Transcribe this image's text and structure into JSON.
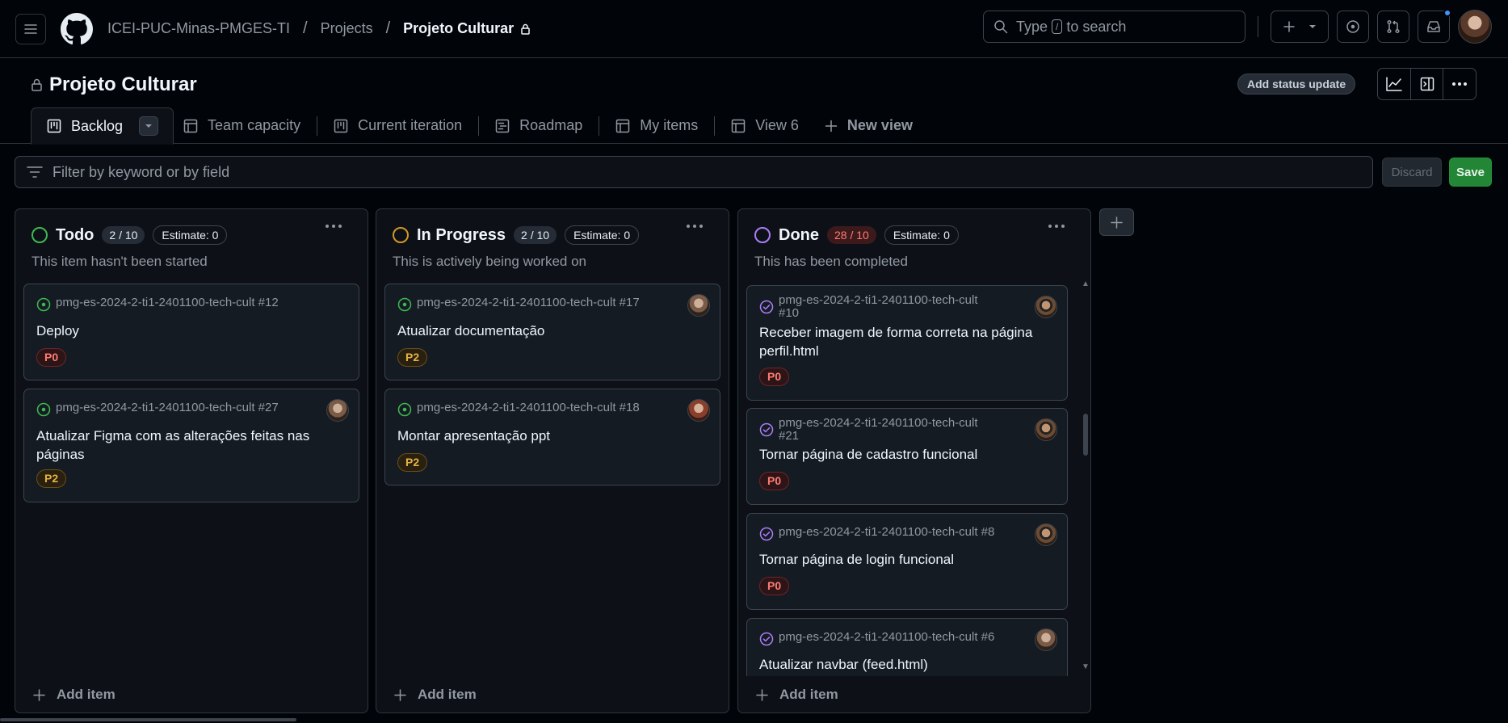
{
  "header": {
    "breadcrumbs": [
      "ICEI-PUC-Minas-PMGES-TI",
      "Projects"
    ],
    "separator": "/",
    "current": "Projeto Culturar",
    "search_prefix": "Type",
    "search_key": "/",
    "search_suffix": "to search"
  },
  "project": {
    "title": "Projeto Culturar",
    "status_update_label": "Add status update"
  },
  "tabs": [
    {
      "label": "Backlog",
      "icon": "board-icon",
      "active": true
    },
    {
      "label": "Team capacity",
      "icon": "table-icon"
    },
    {
      "label": "Current iteration",
      "icon": "board-icon"
    },
    {
      "label": "Roadmap",
      "icon": "roadmap-icon"
    },
    {
      "label": "My items",
      "icon": "table-icon"
    },
    {
      "label": "View 6",
      "icon": "table-icon"
    },
    {
      "label": "New view",
      "icon": "plus-icon"
    }
  ],
  "filter": {
    "placeholder": "Filter by keyword or by field",
    "discard_label": "Discard",
    "save_label": "Save"
  },
  "columns": [
    {
      "name": "Todo",
      "count": "2 / 10",
      "estimate": "Estimate: 0",
      "description": "This item hasn't been started",
      "status_color": "#3fb950",
      "add_item": "Add item",
      "cards": [
        {
          "ref": "pmg-es-2024-2-ti1-2401100-tech-cult #12",
          "title": "Deploy",
          "label": "P0"
        },
        {
          "ref": "pmg-es-2024-2-ti1-2401100-tech-cult #27",
          "title": "Atualizar Figma com as alterações feitas nas páginas",
          "label": "P2"
        }
      ]
    },
    {
      "name": "In Progress",
      "count": "2 / 10",
      "estimate": "Estimate: 0",
      "description": "This is actively being worked on",
      "status_color": "#d29922",
      "add_item": "Add item",
      "cards": [
        {
          "ref": "pmg-es-2024-2-ti1-2401100-tech-cult #17",
          "title": "Atualizar documentação",
          "label": "P2"
        },
        {
          "ref": "pmg-es-2024-2-ti1-2401100-tech-cult #18",
          "title": "Montar apresentação ppt",
          "label": "P2"
        }
      ]
    },
    {
      "name": "Done",
      "count": "28 / 10",
      "estimate": "Estimate: 0",
      "description": "This has been completed",
      "status_color": "#ab7df8",
      "add_item": "Add item",
      "cards": [
        {
          "ref_line1": "pmg-es-2024-2-ti1-2401100-tech-cult",
          "ref_line2": "#10",
          "title": "Receber imagem de forma correta na página perfil.html",
          "label": "P0"
        },
        {
          "ref_line1": "pmg-es-2024-2-ti1-2401100-tech-cult",
          "ref_line2": "#21",
          "title": "Tornar página de cadastro funcional",
          "label": "P0"
        },
        {
          "ref": "pmg-es-2024-2-ti1-2401100-tech-cult #8",
          "title": "Tornar página de login funcional",
          "label": "P0"
        },
        {
          "ref": "pmg-es-2024-2-ti1-2401100-tech-cult #6",
          "title": "Atualizar navbar (feed.html)"
        }
      ]
    }
  ],
  "colors": {
    "background": "#010409",
    "surface": "#0d1117",
    "card": "#151b23",
    "border": "#3d444d",
    "save_green": "#238636",
    "done_purple": "#ab7df8",
    "p0_red": "#ff7b72",
    "p2_yellow": "#e3b341"
  }
}
